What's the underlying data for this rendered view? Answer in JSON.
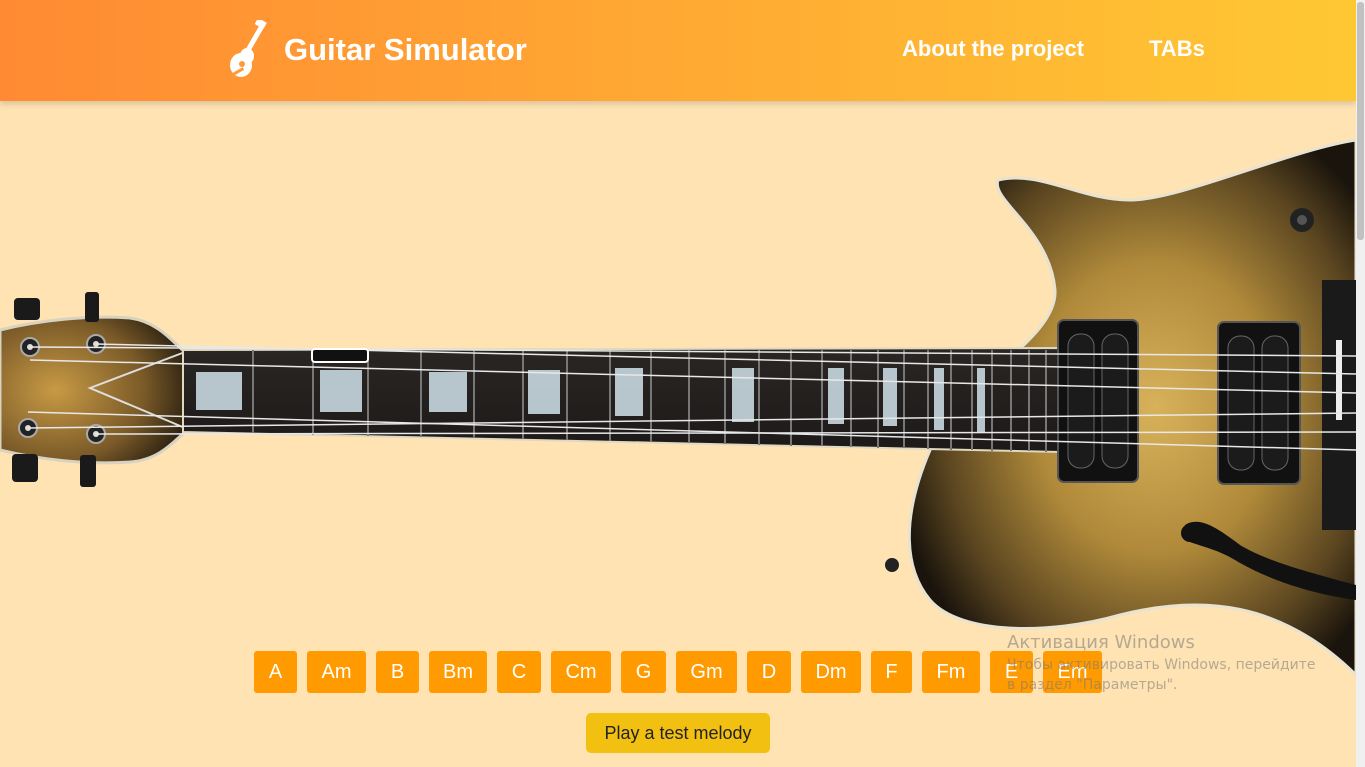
{
  "header": {
    "title": "Guitar Simulator",
    "nav": [
      {
        "label": "About the project"
      },
      {
        "label": "TABs"
      }
    ]
  },
  "chords": [
    "A",
    "Am",
    "B",
    "Bm",
    "C",
    "Cm",
    "G",
    "Gm",
    "D",
    "Dm",
    "F",
    "Fm",
    "E",
    "Em"
  ],
  "melody_button": "Play a test melody",
  "watermark": {
    "title": "Активация Windows",
    "text": "Чтобы активировать Windows, перейдите в раздел \"Параметры\"."
  },
  "colors": {
    "background": "#ffe3b3",
    "header_start": "#ff8a33",
    "header_end": "#ffc833",
    "chord_button": "#ff9a00",
    "melody_button": "#f2c011"
  },
  "icons": {
    "logo": "guitar-icon"
  }
}
